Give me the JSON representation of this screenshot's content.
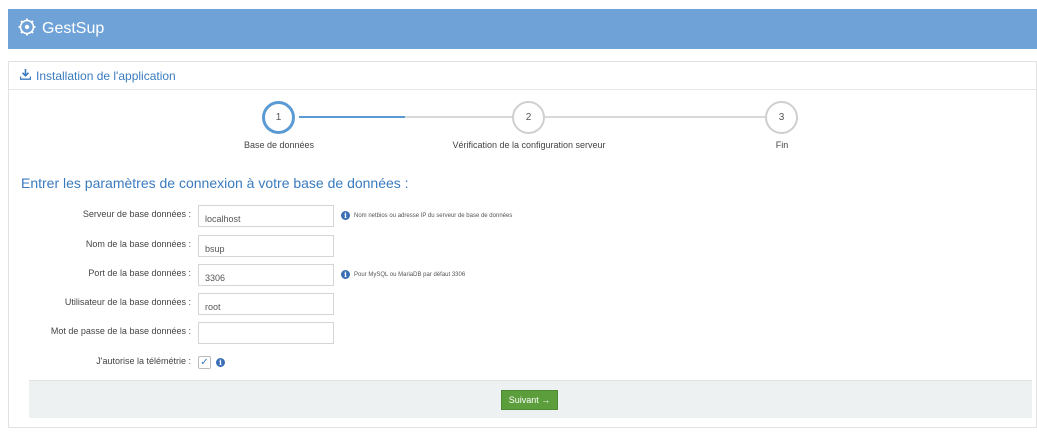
{
  "app": {
    "title": "GestSup",
    "logo_icon": "gear-logo-icon"
  },
  "panel": {
    "title": "Installation de l'application",
    "title_icon": "download-icon"
  },
  "steps": [
    {
      "number": "1",
      "label": "Base de données",
      "state": "active"
    },
    {
      "number": "2",
      "label": "Vérification de la configuration serveur",
      "state": "pending"
    },
    {
      "number": "3",
      "label": "Fin",
      "state": "pending"
    }
  ],
  "heading": "Entrer les paramètres de connexion à votre base de données :",
  "form": {
    "server": {
      "label": "Serveur de base données :",
      "value": "localhost",
      "hint": "Nom netbios ou adresse IP du serveur de base de données"
    },
    "db_name": {
      "label": "Nom de la base données :",
      "value": "bsup"
    },
    "port": {
      "label": "Port de la base données :",
      "value": "3306",
      "hint": "Pour MySQL ou MariaDB par défaut 3306"
    },
    "user": {
      "label": "Utilisateur de la base données :",
      "value": "root"
    },
    "password": {
      "label": "Mot de passe de la base données :",
      "value": ""
    },
    "telemetry": {
      "label": "J'autorise la télémétrie :",
      "checked": true
    }
  },
  "next_button": {
    "label": "Suivant →"
  },
  "colors": {
    "topbar": "#6fa3d8",
    "accent": "#3a7bbf",
    "button": "#5c9d3c"
  }
}
